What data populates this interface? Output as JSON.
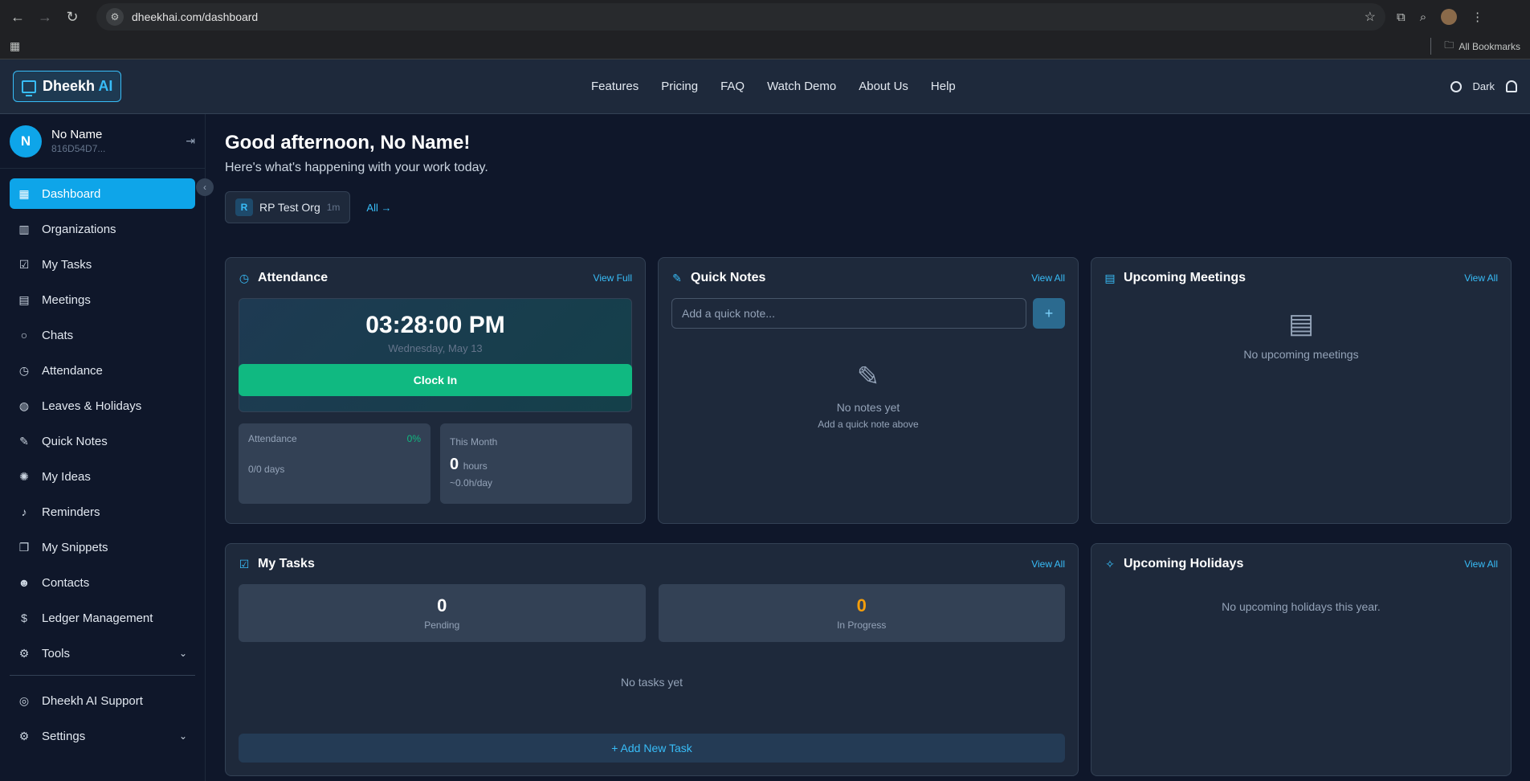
{
  "browser": {
    "url": "dheekhai.com/dashboard",
    "all_bookmarks": "All Bookmarks"
  },
  "header": {
    "logo_main": "Dheekh",
    "logo_ai": "AI",
    "nav": [
      "Features",
      "Pricing",
      "FAQ",
      "Watch Demo",
      "About Us",
      "Help"
    ],
    "theme_label": "Dark"
  },
  "user": {
    "initial": "N",
    "name": "No Name",
    "id": "816D54D7..."
  },
  "sidebar": {
    "items": [
      {
        "label": "Dashboard",
        "icon": "grid-icon"
      },
      {
        "label": "Organizations",
        "icon": "building-icon"
      },
      {
        "label": "My Tasks",
        "icon": "clipboard-icon"
      },
      {
        "label": "Meetings",
        "icon": "calendar-icon"
      },
      {
        "label": "Chats",
        "icon": "chat-icon"
      },
      {
        "label": "Attendance",
        "icon": "clock-icon"
      },
      {
        "label": "Leaves & Holidays",
        "icon": "globe-icon"
      },
      {
        "label": "Quick Notes",
        "icon": "edit-icon"
      },
      {
        "label": "My Ideas",
        "icon": "bulb-icon"
      },
      {
        "label": "Reminders",
        "icon": "bell-icon"
      },
      {
        "label": "My Snippets",
        "icon": "copy-icon"
      },
      {
        "label": "Contacts",
        "icon": "users-icon"
      },
      {
        "label": "Ledger Management",
        "icon": "dollar-icon"
      },
      {
        "label": "Tools",
        "icon": "gear-icon"
      }
    ],
    "support": "Dheekh AI Support",
    "settings": "Settings"
  },
  "main": {
    "greeting": "Good afternoon, No Name!",
    "subgreeting": "Here's what's happening with your work today.",
    "org": {
      "initial": "R",
      "name": "RP Test Org",
      "time": "1m",
      "all": "All →"
    }
  },
  "attendance": {
    "title": "Attendance",
    "link": "View Full",
    "time": "03:28:00 PM",
    "date": "Wednesday, May 13",
    "clock_in": "Clock In",
    "att_label": "Attendance",
    "att_pct": "0%",
    "att_days": "0/0 days",
    "month_label": "This Month",
    "month_hours": "0",
    "hours_unit": "hours",
    "per_day": "~0.0h/day"
  },
  "notes": {
    "title": "Quick Notes",
    "link": "View All",
    "placeholder": "Add a quick note...",
    "add": "+",
    "empty1": "No notes yet",
    "empty2": "Add a quick note above"
  },
  "meetings": {
    "title": "Upcoming Meetings",
    "link": "View All",
    "empty": "No upcoming meetings"
  },
  "tasks": {
    "title": "My Tasks",
    "link": "View All",
    "pending_count": "0",
    "pending_label": "Pending",
    "progress_count": "0",
    "progress_label": "In Progress",
    "empty": "No tasks yet",
    "add": "+ Add New Task"
  },
  "holidays": {
    "title": "Upcoming Holidays",
    "link": "View All",
    "empty": "No upcoming holidays this year."
  }
}
